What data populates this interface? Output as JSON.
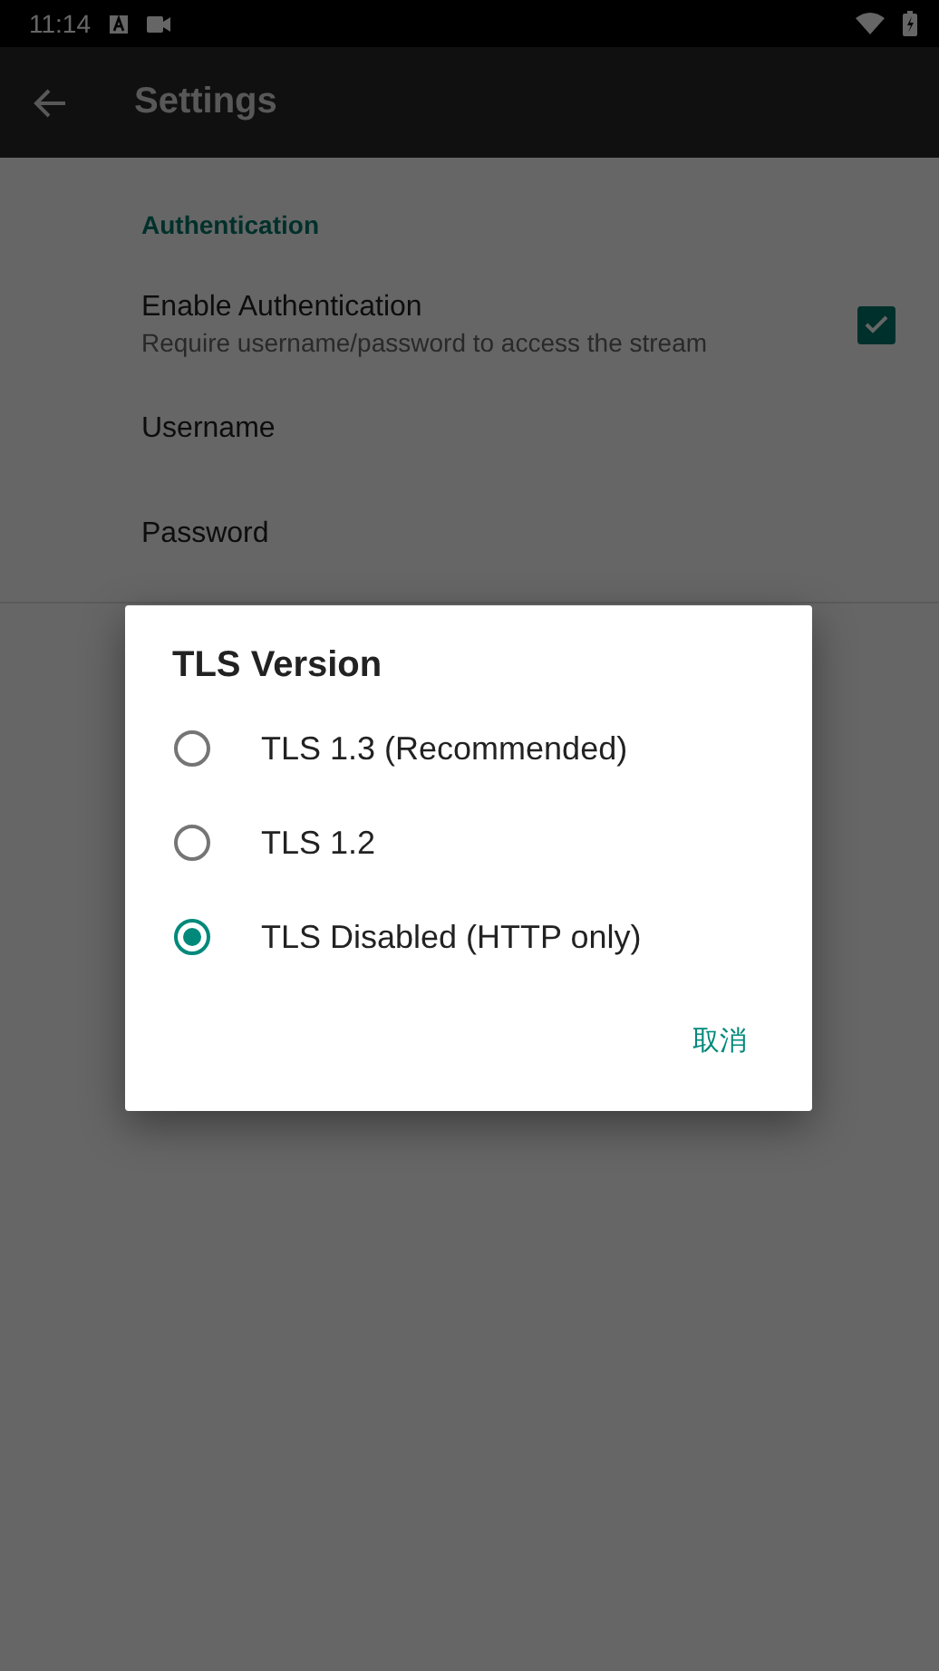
{
  "status_bar": {
    "time": "11:14"
  },
  "app_bar": {
    "title": "Settings"
  },
  "section": {
    "title": "Authentication"
  },
  "preferences": [
    {
      "kind": "checkbox",
      "title": "Enable Authentication",
      "summary": "Require username/password to access the stream",
      "checked": true
    },
    {
      "kind": "text",
      "title": "Username"
    },
    {
      "kind": "text",
      "title": "Password"
    }
  ],
  "dialog": {
    "title": "TLS Version",
    "options": [
      {
        "label": "TLS 1.3 (Recommended)",
        "selected": false
      },
      {
        "label": "TLS 1.2",
        "selected": false
      },
      {
        "label": "TLS Disabled (HTTP only)",
        "selected": true
      }
    ],
    "buttons": [
      "取消"
    ]
  }
}
